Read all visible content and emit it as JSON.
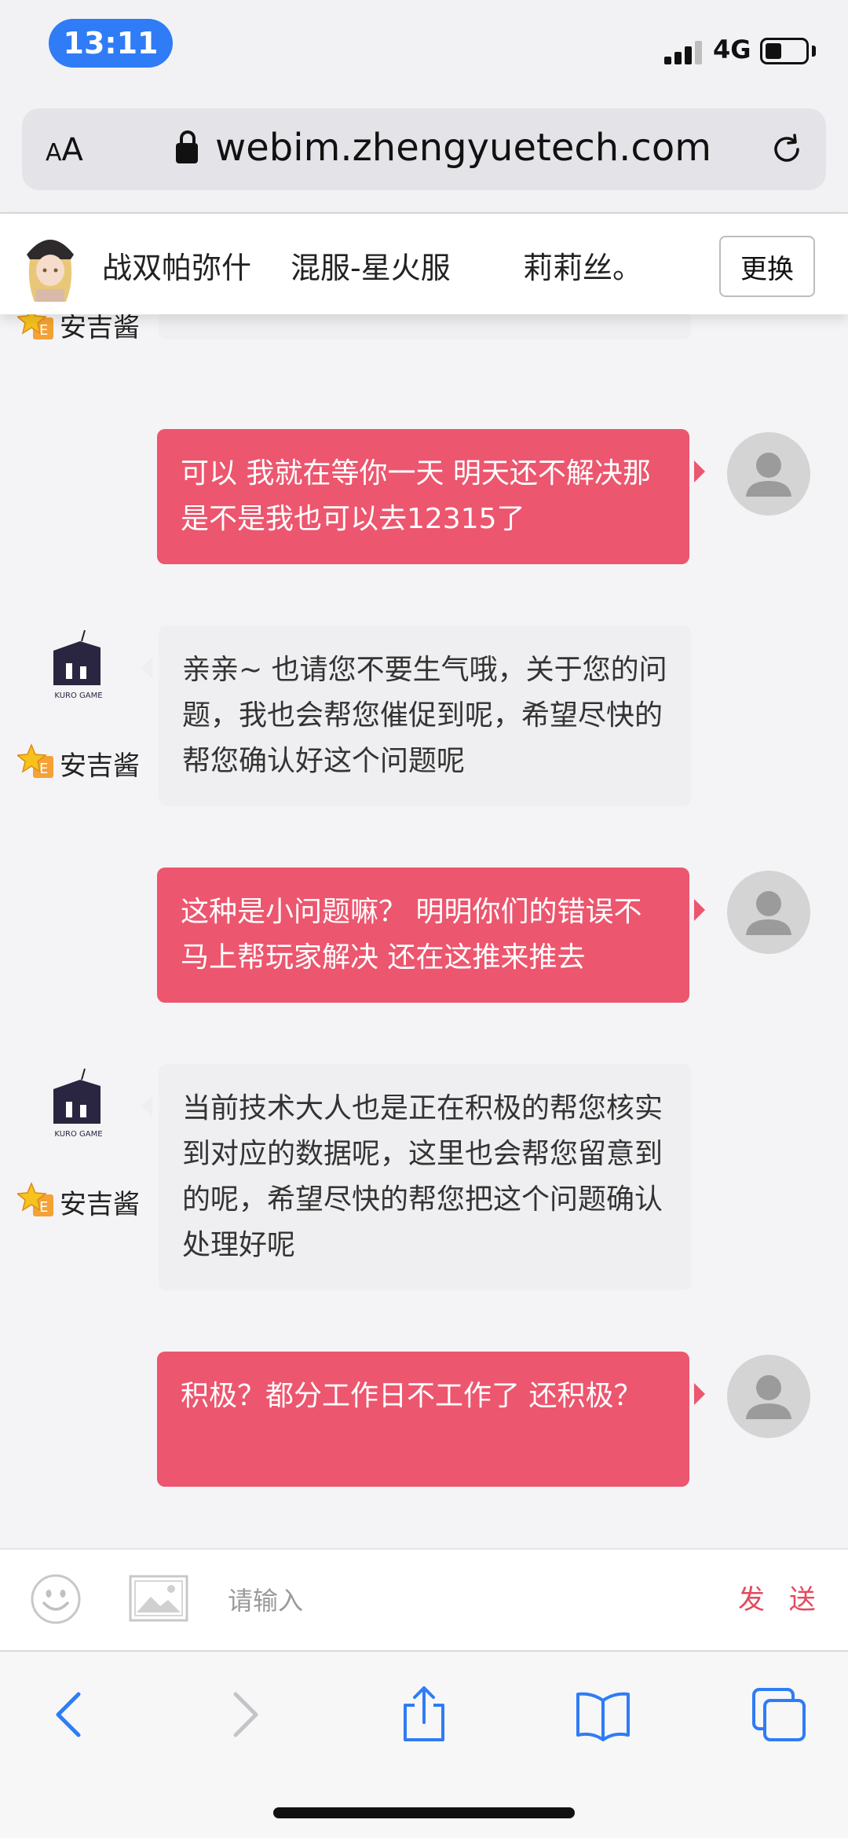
{
  "status": {
    "time": "13:11",
    "network": "4G"
  },
  "browser": {
    "text_size_label": "AA",
    "url": "webim.zhengyuetech.com"
  },
  "header": {
    "game": "战双帕弥什",
    "server": "混服-星火服",
    "character": "莉莉丝。",
    "switch_label": "更换"
  },
  "messages": [
    {
      "from": "agent",
      "agent_name": "安吉酱",
      "text": ""
    },
    {
      "from": "user",
      "text": "可以 我就在等你一天 明天还不解决那是不是我也可以去12315了"
    },
    {
      "from": "agent",
      "agent_name": "安吉酱",
      "text": "亲亲~ 也请您不要生气哦，关于您的问题，我也会帮您催促到呢，希望尽快的帮您确认好这个问题呢"
    },
    {
      "from": "user",
      "text": "这种是小问题嘛？ 明明你们的错误不马上帮玩家解决 还在这推来推去"
    },
    {
      "from": "agent",
      "agent_name": "安吉酱",
      "text": "当前技术大人也是正在积极的帮您核实到对应的数据呢，这里也会帮您留意到的呢，希望尽快的帮您把这个问题确认处理好呢"
    },
    {
      "from": "user",
      "text": "积极？都分工作日不工作了 还积极？"
    }
  ],
  "logo_text": "KURO GAME",
  "input": {
    "placeholder": "请输入",
    "send_label": "发 送"
  },
  "colors": {
    "user_bubble": "#ec566e",
    "agent_bubble": "#efeff1",
    "accent": "#2f7cf6",
    "send": "#e34a5f"
  },
  "icons": [
    "emoji-icon",
    "image-icon",
    "back-icon",
    "forward-icon",
    "share-icon",
    "bookmarks-icon",
    "tabs-icon"
  ]
}
